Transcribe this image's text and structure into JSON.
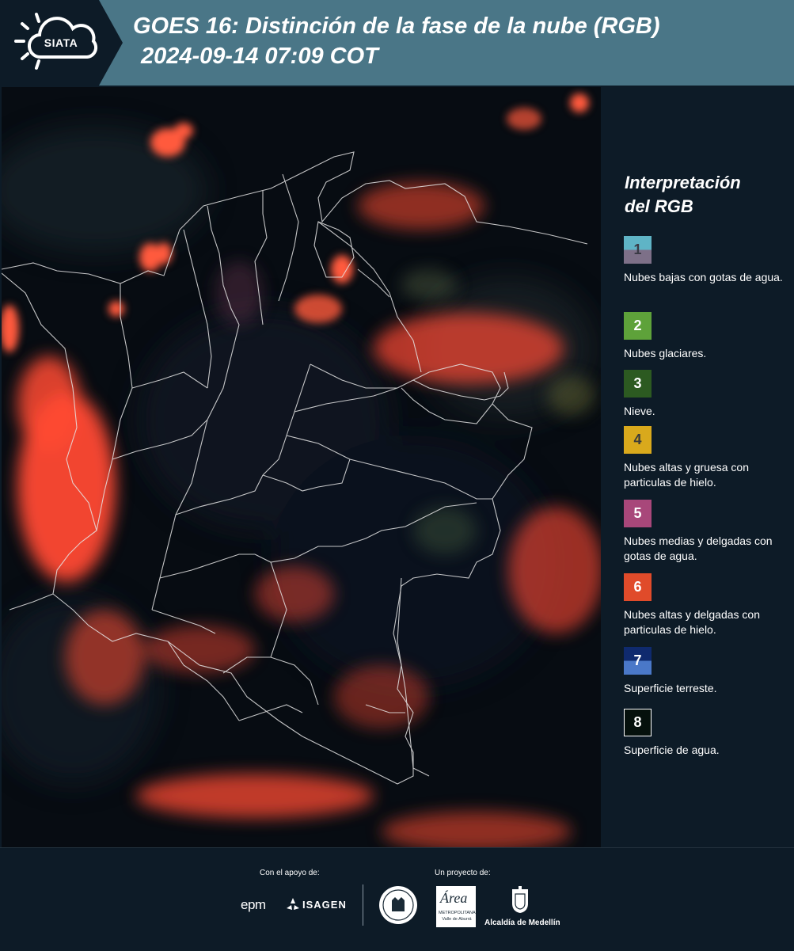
{
  "header": {
    "logo_text": "SIATA",
    "title_line1": "GOES 16: Distinción de la fase de la nube (RGB)",
    "title_line2": "2024-09-14 07:09 COT"
  },
  "legend": {
    "title_line1": "Interpretación",
    "title_line2": "del RGB",
    "items": [
      {
        "number": "1",
        "desc": "Nubes bajas con gotas de agua.",
        "color_top": "#5fb4c6",
        "color_bottom": "#7d7088",
        "text_color": "#3a3a45"
      },
      {
        "number": "2",
        "desc": "Nubes glaciares.",
        "color_top": "#5ea23a",
        "color_bottom": "#5ea23a",
        "text_color": "#ffffff"
      },
      {
        "number": "3",
        "desc": "Nieve.",
        "color_top": "#2c5a21",
        "color_bottom": "#2c5a21",
        "text_color": "#ffffff"
      },
      {
        "number": "4",
        "desc": "Nubes altas y gruesa con particulas de hielo.",
        "color_top": "#d9a91c",
        "color_bottom": "#d9a91c",
        "text_color": "#3a3a3a"
      },
      {
        "number": "5",
        "desc": "Nubes medias y delgadas con gotas de agua.",
        "color_top": "#a8477a",
        "color_bottom": "#a8477a",
        "text_color": "#ffffff"
      },
      {
        "number": "6",
        "desc": "Nubes altas y delgadas con particulas de hielo.",
        "color_top": "#e04b2a",
        "color_bottom": "#e04b2a",
        "text_color": "#ffffff"
      },
      {
        "number": "7",
        "desc": "Superficie terreste.",
        "color_top": "#0f2a6e",
        "color_bottom": "#4a78c8",
        "text_color": "#ffffff"
      },
      {
        "number": "8",
        "desc": "Superficie de agua.",
        "color_top": "#05100c",
        "color_bottom": "#05100c",
        "text_color": "#ffffff"
      }
    ]
  },
  "footer": {
    "support_label": "Con el apoyo de:",
    "project_label": "Un proyecto de:",
    "epm": "epm",
    "isagen": "ISAGEN",
    "area_text": "Área",
    "area_sub1": "METROPOLITANA",
    "area_sub2": "Valle de Aburrá",
    "alcaldia": "Alcaldía de Medellín"
  },
  "colors": {
    "header_bg": "#4a7687",
    "page_bg": "#0d1b27",
    "map_bg": "#070c12",
    "cloud_red": "#ff4a32"
  }
}
